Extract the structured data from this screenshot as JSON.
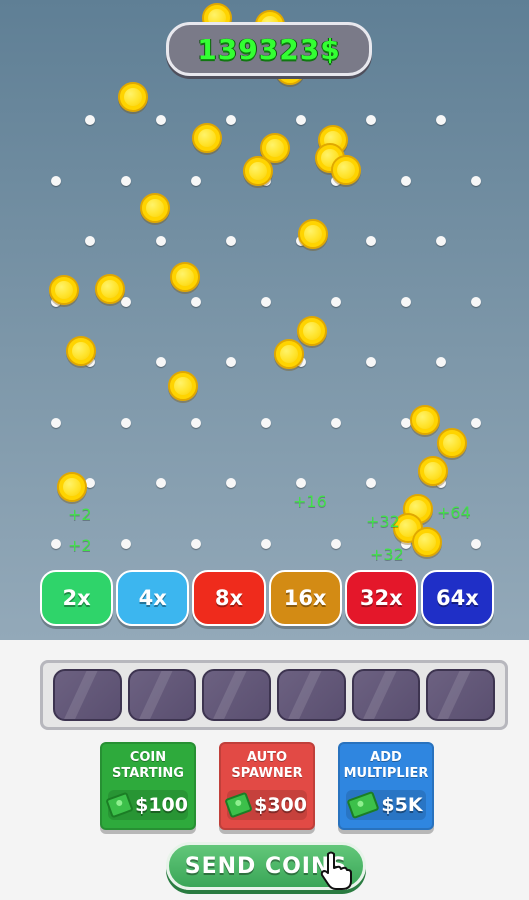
{
  "balance": "139323$",
  "multipliers": [
    {
      "label": "2x",
      "color": "#2fd46a"
    },
    {
      "label": "4x",
      "color": "#3cb6ef"
    },
    {
      "label": "8x",
      "color": "#ef2b1c"
    },
    {
      "label": "16x",
      "color": "#d38b14"
    },
    {
      "label": "32x",
      "color": "#e4172a"
    },
    {
      "label": "64x",
      "color": "#1f2fc7"
    }
  ],
  "floating_rewards": [
    "+2",
    "+2",
    "+16",
    "+32",
    "+32",
    "+64"
  ],
  "slots_count": 6,
  "upgrades": [
    {
      "title": "COIN\nSTARTING",
      "price": "$100",
      "color": "#2eaa3c"
    },
    {
      "title": "AUTO\nSPAWNER",
      "price": "$300",
      "color": "#e24a45"
    },
    {
      "title": "ADD\nMULTIPLIER",
      "price": "$5K",
      "color": "#2f86e0"
    }
  ],
  "send_button": "SEND COINS",
  "icons": {
    "coin": "gold-coin-icon",
    "cash": "cash-icon",
    "hand": "pointer-hand-icon"
  }
}
